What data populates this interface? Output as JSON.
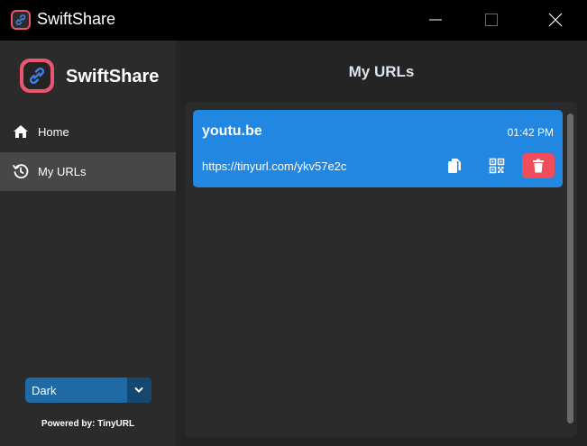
{
  "window": {
    "title": "SwiftShare",
    "icon": "link-icon"
  },
  "sidebar": {
    "brand": "SwiftShare",
    "items": [
      {
        "label": "Home",
        "icon": "home-icon",
        "active": false
      },
      {
        "label": "My URLs",
        "icon": "history-icon",
        "active": true
      }
    ],
    "theme": {
      "selected": "Dark"
    },
    "powered_by": "Powered by: TinyURL"
  },
  "main": {
    "title": "My URLs",
    "urls": [
      {
        "domain": "youtu.be",
        "time": "01:42 PM",
        "short_url": "https://tinyurl.com/ykv57e2c"
      }
    ]
  },
  "colors": {
    "accent": "#2287e1",
    "brand": "#e9566f",
    "delete": "#ef4d5a",
    "dropdown": "#1f6aa5"
  }
}
